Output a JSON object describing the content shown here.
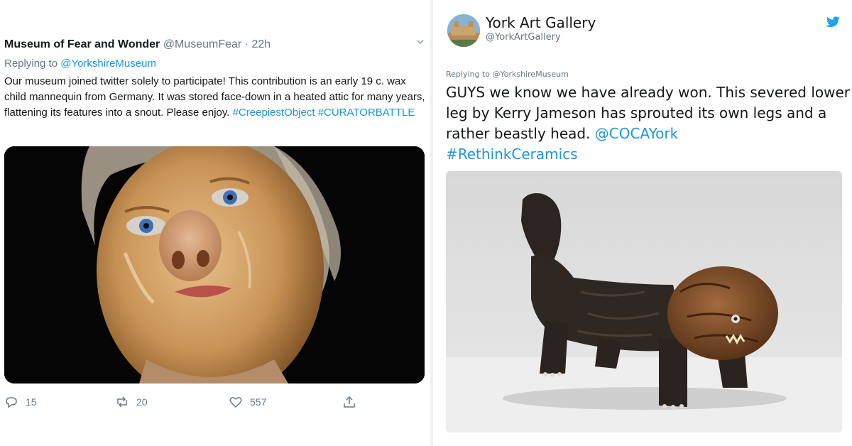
{
  "left_tweet": {
    "author_name": "Museum of Fear and Wonder",
    "author_handle": "@MuseumFear",
    "separator": "·",
    "time": "22h",
    "replying_prefix": "Replying to ",
    "replying_handle": "@YorkshireMuseum",
    "body": "Our museum joined twitter solely to participate! This contribution is an early 19 c. wax child mannequin from Germany. It was stored face-down in a heated attic for many years, flattening its features into a snout. Please enjoy.",
    "hashtag_1": "#CreepiestObject",
    "hashtag_2": "#CURATORBATTLE",
    "media_icon": "wax-mannequin-photo",
    "actions": {
      "reply_count": "15",
      "retweet_count": "20",
      "like_count": "557"
    },
    "icons": [
      "chevron-down-icon",
      "reply-icon",
      "retweet-icon",
      "like-icon",
      "share-icon"
    ]
  },
  "right_tweet": {
    "author_name": "York Art Gallery",
    "author_handle": "@YorkArtGallery",
    "replying": "Replying to @YorkshireMuseum",
    "body": "GUYS we know we have already won. This severed lower leg by Kerry Jameson has sprouted its own legs and a rather beastly head.",
    "mention": "@COCAYork",
    "hashtag": "#RethinkCeramics",
    "media_icon": "ceramic-leg-creature-photo",
    "icons": [
      "avatar",
      "twitter-bird-icon"
    ],
    "accent_color": "#1da1f2"
  },
  "colors": {
    "link": "#1b95e0",
    "secondary_text": "#657786",
    "primary_text": "#14171a"
  }
}
